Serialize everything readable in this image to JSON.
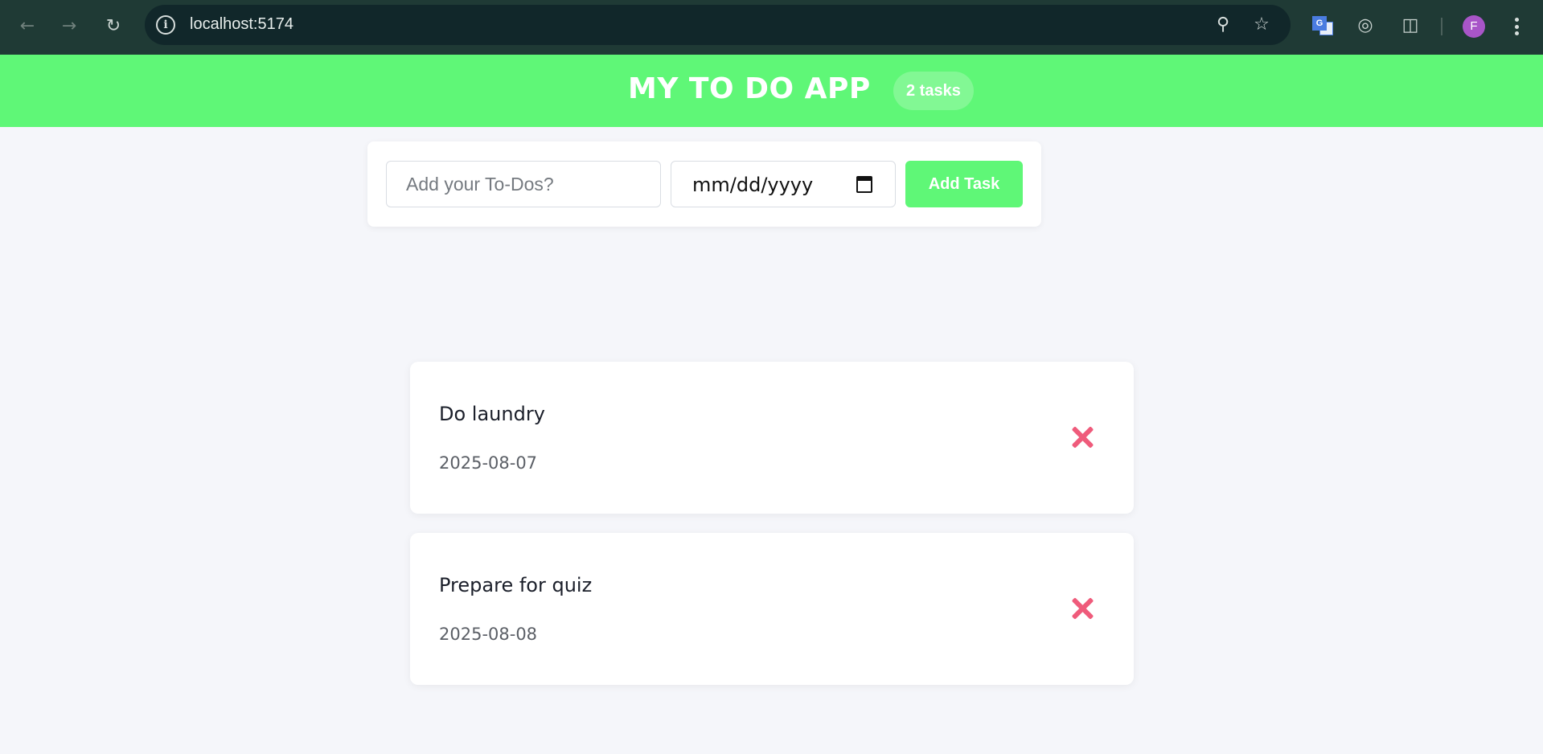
{
  "browser": {
    "url": "localhost:5174",
    "avatar_letter": "F",
    "icons": {
      "back": "arrow-left-icon",
      "forward": "arrow-right-icon",
      "reload": "reload-icon",
      "site_info": "info-icon",
      "zoom": "zoom-in-icon",
      "bookmark": "star-icon",
      "translate": "google-translate-icon",
      "globe": "globe-icon",
      "extensions": "puzzle-icon",
      "menu": "kebab-menu-icon"
    }
  },
  "app": {
    "title": "MY TO DO APP",
    "task_count": "2 tasks",
    "accent_color": "#5ff777",
    "delete_color": "#ef5b7b"
  },
  "form": {
    "todo_placeholder": "Add your To-Dos?",
    "todo_value": "",
    "date_placeholder": "mm/dd/yyyy",
    "add_button_label": "Add Task"
  },
  "tasks": [
    {
      "title": "Do laundry",
      "date": "2025-08-07"
    },
    {
      "title": "Prepare for quiz",
      "date": "2025-08-08"
    }
  ]
}
